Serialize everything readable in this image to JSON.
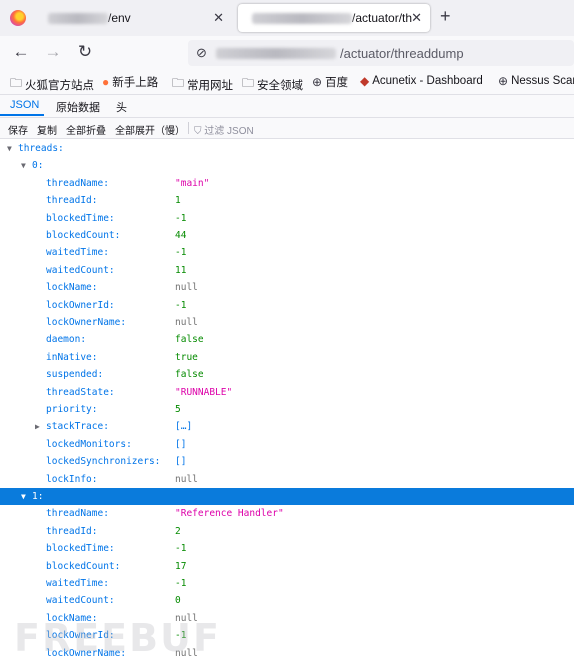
{
  "browser": {
    "tabs": [
      {
        "title": "/env",
        "active": false,
        "close": "✕"
      },
      {
        "title": "/actuator/th",
        "active": true,
        "close": "✕"
      }
    ],
    "new_tab": "+",
    "url_path": "/actuator/threaddump"
  },
  "bookmarks": [
    {
      "icon": "folder-icon",
      "label": "火狐官方站点"
    },
    {
      "icon": "firefox-icon",
      "label": "新手上路"
    },
    {
      "icon": "folder-icon",
      "label": "常用网址"
    },
    {
      "icon": "folder-icon",
      "label": "安全领域"
    },
    {
      "icon": "globe-icon",
      "label": "百度"
    },
    {
      "icon": "acunetix-icon",
      "label": "Acunetix - Dashboard"
    },
    {
      "icon": "globe-icon",
      "label": "Nessus Scan"
    }
  ],
  "viewer": {
    "tabs": [
      "JSON",
      "原始数据",
      "头"
    ],
    "actions": [
      "保存",
      "复制",
      "全部折叠",
      "全部展开（慢）"
    ],
    "filter_placeholder": "过滤 JSON"
  },
  "tree": {
    "root_key": "threads:",
    "thread0_key": "0:",
    "thread0": [
      {
        "key": "threadName:",
        "value": "\"main\"",
        "type": "str"
      },
      {
        "key": "threadId:",
        "value": "1",
        "type": "num"
      },
      {
        "key": "blockedTime:",
        "value": "-1",
        "type": "num"
      },
      {
        "key": "blockedCount:",
        "value": "44",
        "type": "num"
      },
      {
        "key": "waitedTime:",
        "value": "-1",
        "type": "num"
      },
      {
        "key": "waitedCount:",
        "value": "11",
        "type": "num"
      },
      {
        "key": "lockName:",
        "value": "null",
        "type": "null"
      },
      {
        "key": "lockOwnerId:",
        "value": "-1",
        "type": "num"
      },
      {
        "key": "lockOwnerName:",
        "value": "null",
        "type": "null"
      },
      {
        "key": "daemon:",
        "value": "false",
        "type": "num"
      },
      {
        "key": "inNative:",
        "value": "true",
        "type": "num"
      },
      {
        "key": "suspended:",
        "value": "false",
        "type": "num"
      },
      {
        "key": "threadState:",
        "value": "\"RUNNABLE\"",
        "type": "str"
      },
      {
        "key": "priority:",
        "value": "5",
        "type": "num"
      },
      {
        "key": "stackTrace:",
        "value": "[…]",
        "type": "plain",
        "collapsed": true
      },
      {
        "key": "lockedMonitors:",
        "value": "[]",
        "type": "plain"
      },
      {
        "key": "lockedSynchronizers:",
        "value": "[]",
        "type": "plain"
      },
      {
        "key": "lockInfo:",
        "value": "null",
        "type": "null"
      }
    ],
    "thread1_key": "1:",
    "thread1": [
      {
        "key": "threadName:",
        "value": "\"Reference Handler\"",
        "type": "str"
      },
      {
        "key": "threadId:",
        "value": "2",
        "type": "num"
      },
      {
        "key": "blockedTime:",
        "value": "-1",
        "type": "num"
      },
      {
        "key": "blockedCount:",
        "value": "17",
        "type": "num"
      },
      {
        "key": "waitedTime:",
        "value": "-1",
        "type": "num"
      },
      {
        "key": "waitedCount:",
        "value": "0",
        "type": "num"
      },
      {
        "key": "lockName:",
        "value": "null",
        "type": "null"
      },
      {
        "key": "lockOwnerId:",
        "value": "-1",
        "type": "num"
      },
      {
        "key": "lockOwnerName:",
        "value": "null",
        "type": "null"
      }
    ]
  },
  "watermark": "FREEBUF"
}
